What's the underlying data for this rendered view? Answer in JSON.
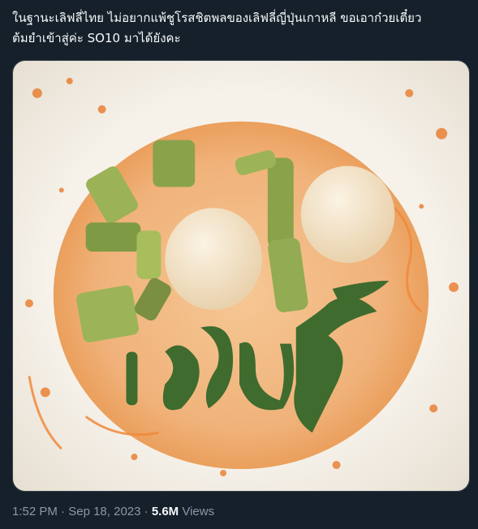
{
  "tweet": {
    "text_line_1": "ในฐานะเลิฟลี่ไทย ไม่อยากแพ้ชูโรสชิตพลของเลิฟลี่ญี่ปุ่นเกาหลี ขอเอาก๋วยเตี๋ยว",
    "text_line_2": "ต้มยำเข้าสู่ค่ะ SO10 มาได้ยังคะ",
    "time": "1:52 PM",
    "separator": "·",
    "date": "Sep 18, 2023",
    "views_count": "5.6M",
    "views_label": "Views"
  },
  "media": {
    "alt_subject": "tom-yum-noodle-soup-photo",
    "leaf_text": "เลิฟลี่",
    "colors": {
      "broth": "#f0b27a",
      "bowl": "#f3efe8",
      "leaf": "#3f6b2e",
      "fishball": "#f4e6cf",
      "morning_glory": "#8aa24a"
    }
  },
  "colors": {
    "background": "#15202b",
    "text": "#f7f9f9",
    "muted": "#8b98a5",
    "border": "#38444d"
  }
}
